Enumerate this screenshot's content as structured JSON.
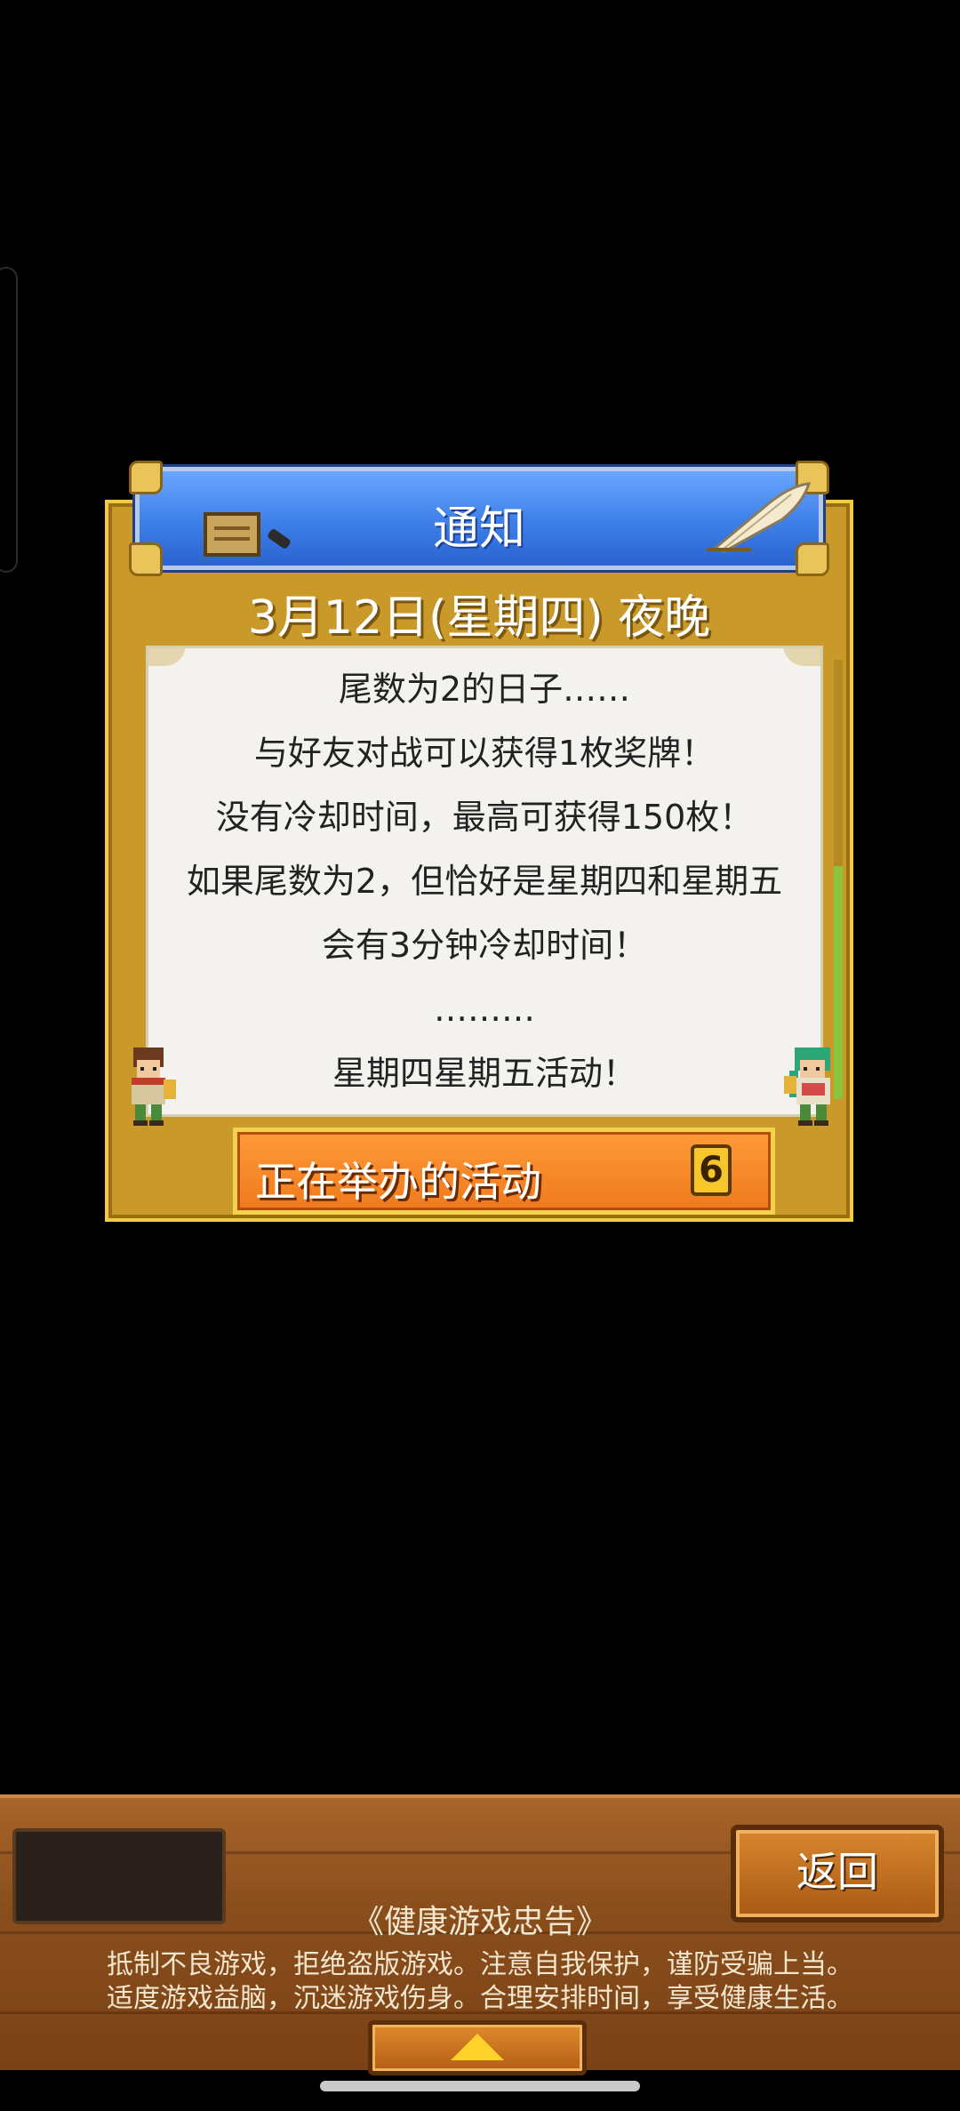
{
  "dialog": {
    "title": "通知",
    "date": "3月12日(星期四) 夜晚",
    "lines": [
      "尾数为2的日子……",
      "与好友对战可以获得1枚奖牌！",
      "没有冷却时间，最高可获得150枚！",
      "如果尾数为2，但恰好是星期四和星期五",
      "会有3分钟冷却时间！",
      "………",
      "星期四星期五活动！"
    ],
    "event_button": {
      "label": "正在举办的活动",
      "count": "6"
    },
    "scroll_position": 0.47
  },
  "bottom_bar": {
    "back_label": "返回",
    "health_title": "《健康游戏忠告》",
    "health_line1": "抵制不良游戏，拒绝盗版游戏。注意自我保护，谨防受骗上当。",
    "health_line2": "适度游戏益脑，沉迷游戏伤身。合理安排时间，享受健康生活。"
  },
  "icons": {
    "board": "signboard-icon",
    "brush": "brush-icon",
    "quill": "quill-icon",
    "character_left": "character-left-icon",
    "character_right": "character-right-icon",
    "up_arrow": "up-arrow-icon"
  },
  "colors": {
    "dialog_gold": "#c99a2a",
    "title_blue": "#3d7fe8",
    "event_orange": "#ef7a1c",
    "wood": "#8a4e1c"
  }
}
